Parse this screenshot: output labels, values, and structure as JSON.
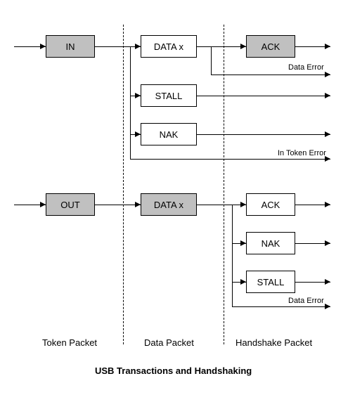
{
  "title": "USB Transactions and Handshaking",
  "columns": {
    "token": "Token Packet",
    "data": "Data Packet",
    "handshake": "Handshake Packet"
  },
  "in_flow": {
    "token": "IN",
    "data": "DATA x",
    "handshake": "ACK",
    "alt1": "STALL",
    "alt2": "NAK",
    "err1": "Data Error",
    "err2": "In Token Error"
  },
  "out_flow": {
    "token": "OUT",
    "data": "DATA x",
    "h1": "ACK",
    "h2": "NAK",
    "h3": "STALL",
    "err": "Data Error"
  }
}
